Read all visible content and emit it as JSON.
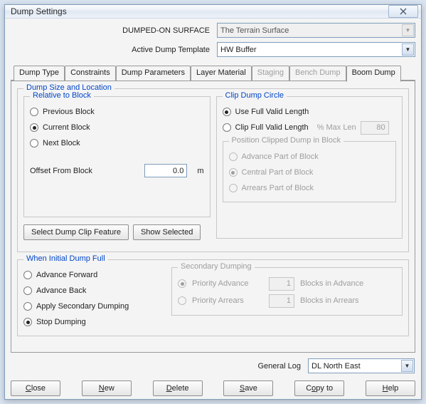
{
  "window": {
    "title": "Dump Settings"
  },
  "header": {
    "surface_label": "DUMPED-ON SURFACE",
    "surface_value": "The Terrain Surface",
    "template_label": "Active Dump Template",
    "template_value": "HW Buffer"
  },
  "tabs": [
    {
      "label": "Dump Type"
    },
    {
      "label": "Constraints"
    },
    {
      "label": "Dump Parameters"
    },
    {
      "label": "Layer Material"
    },
    {
      "label": "Staging"
    },
    {
      "label": "Bench Dump"
    },
    {
      "label": "Boom Dump"
    }
  ],
  "size_loc": {
    "legend": "Dump Size and Location",
    "relative": {
      "legend": "Relative to Block",
      "opts": [
        "Previous Block",
        "Current Block",
        "Next Block"
      ],
      "offset_label": "Offset From Block",
      "offset_value": "0.0",
      "offset_unit": "m",
      "btn_select": "Select Dump Clip Feature",
      "btn_show": "Show Selected"
    },
    "clip": {
      "legend": "Clip Dump Circle",
      "opt_full": "Use Full Valid Length",
      "opt_clip": "Clip Full Valid Length",
      "maxlen_label": "% Max Len",
      "maxlen_value": "80",
      "pos": {
        "legend": "Position Clipped Dump in Block",
        "opts": [
          "Advance Part of Block",
          "Central Part of Block",
          "Arrears Part of Block"
        ]
      }
    }
  },
  "initial": {
    "legend": "When Initial Dump Full",
    "opts": [
      "Advance Forward",
      "Advance Back",
      "Apply Secondary Dumping",
      "Stop Dumping"
    ],
    "secondary": {
      "legend": "Secondary Dumping",
      "row1_label": "Priority Advance",
      "row1_value": "1",
      "row1_after": "Blocks in Advance",
      "row2_label": "Priority Arrears",
      "row2_value": "1",
      "row2_after": "Blocks in Arrears"
    }
  },
  "footer": {
    "log_label": "General Log",
    "log_value": "DL North East",
    "buttons": {
      "close": "Close",
      "new": "New",
      "delete": "Delete",
      "save": "Save",
      "copyto": "Copy to",
      "help": "Help"
    }
  }
}
